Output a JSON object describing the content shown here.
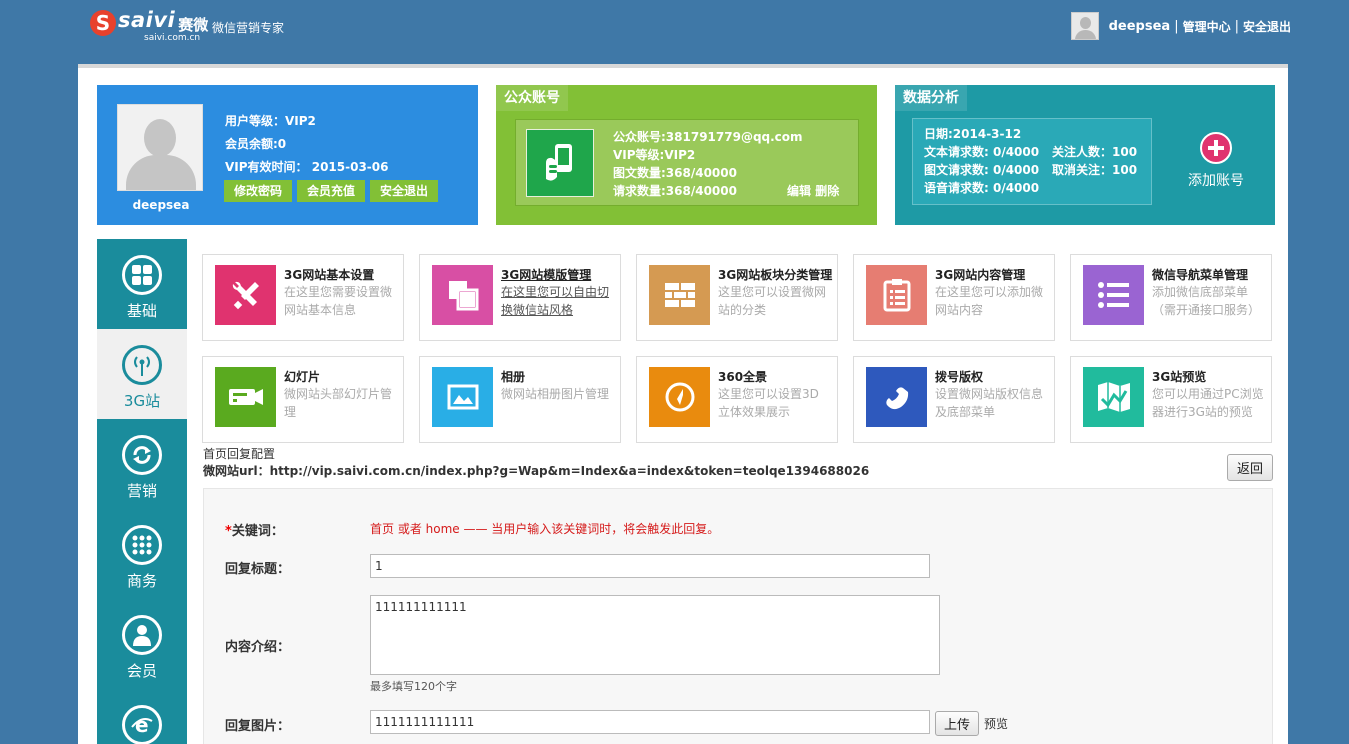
{
  "header": {
    "logo_letter": "S",
    "logo_word": "saivi",
    "logo_cn": "赛微",
    "logo_domain": "saivi.com.cn",
    "slogan": "微信营销专家",
    "username": "deepsea",
    "sep": "|",
    "admin_link": "管理中心",
    "logout_link": "安全退出"
  },
  "profile": {
    "name": "deepsea",
    "level": "用户等级：VIP2",
    "balance": "会员余额:0",
    "vip_expiry": "VIP有效时间： 2015-03-06",
    "buttons": [
      "修改密码",
      "会员充值",
      "安全退出"
    ]
  },
  "account": {
    "title": "公众账号",
    "id_line": "公众账号:381791779@qq.com",
    "vip_line": "VIP等级:VIP2",
    "articles_line": "图文数量:368/40000",
    "requests_line": "请求数量:368/40000",
    "edit": "编辑",
    "delete": "删除"
  },
  "analytics": {
    "title": "数据分析",
    "date": "日期:2014-3-12",
    "text_req": "文本请求数: 0/4000",
    "follows": "关注人数：100",
    "img_req": "图文请求数: 0/4000",
    "unfollows": "取消关注：100",
    "voice_req": "语音请求数: 0/4000",
    "add_account": "添加账号"
  },
  "sidebar": {
    "items": [
      {
        "label": "基础",
        "icon": "grid-icon"
      },
      {
        "label": "3G站",
        "icon": "antenna-icon"
      },
      {
        "label": "营销",
        "icon": "refresh-icon"
      },
      {
        "label": "商务",
        "icon": "dots-icon"
      },
      {
        "label": "会员",
        "icon": "person-icon"
      },
      {
        "label": "",
        "icon": "browser-icon"
      }
    ]
  },
  "modules": [
    {
      "title": "3G网站基本设置",
      "desc": "在这里您需要设置微网站基本信息",
      "color": "#e0336f",
      "icon": "tools-icon"
    },
    {
      "title": "3G网站模版管理",
      "desc": "在这里您可以自由切换微信站风格",
      "color": "#d84fa4",
      "icon": "template-icon"
    },
    {
      "title": "3G网站板块分类管理",
      "desc": "这里您可以设置微网站的分类",
      "color": "#d59a52",
      "icon": "bricks-icon"
    },
    {
      "title": "3G网站内容管理",
      "desc": "在这里您可以添加微网站内容",
      "color": "#e67d72",
      "icon": "clipboard-icon"
    },
    {
      "title": "微信导航菜单管理",
      "desc": "添加微信底部菜单（需开通接口服务）",
      "color": "#9a64d2",
      "icon": "list-icon"
    },
    {
      "title": "幻灯片",
      "desc": "微网站头部幻灯片管理",
      "color": "#5aaa1f",
      "icon": "projector-icon"
    },
    {
      "title": "相册",
      "desc": "微网站相册图片管理",
      "color": "#29aee6",
      "icon": "picture-icon"
    },
    {
      "title": "360全景",
      "desc": "这里您可以设置3D立体效果展示",
      "color": "#e98b0e",
      "icon": "compass-icon"
    },
    {
      "title": "拨号版权",
      "desc": "设置微网站版权信息及底部菜单",
      "color": "#2e59bd",
      "icon": "phone-icon"
    },
    {
      "title": "3G站预览",
      "desc": "您可以用通过PC浏览器进行3G站的预览",
      "color": "#21bb9d",
      "icon": "map-icon"
    }
  ],
  "config": {
    "title": "首页回复配置",
    "url": "微网站url：http://vip.saivi.com.cn/index.php?g=Wap&m=Index&a=index&token=teolqe1394688026",
    "back": "返回"
  },
  "form": {
    "keyword_star": "*",
    "keyword_label": "关键词：",
    "keyword_hint": "首页 或者 home —— 当用户输入该关键词时，将会触发此回复。",
    "title_label": "回复标题：",
    "title_value": "1",
    "intro_label": "内容介绍：",
    "intro_value": "111111111111",
    "intro_hint": "最多填写120个字",
    "image_label": "回复图片：",
    "image_value": "1111111111111",
    "upload": "上传",
    "preview": "预览"
  }
}
